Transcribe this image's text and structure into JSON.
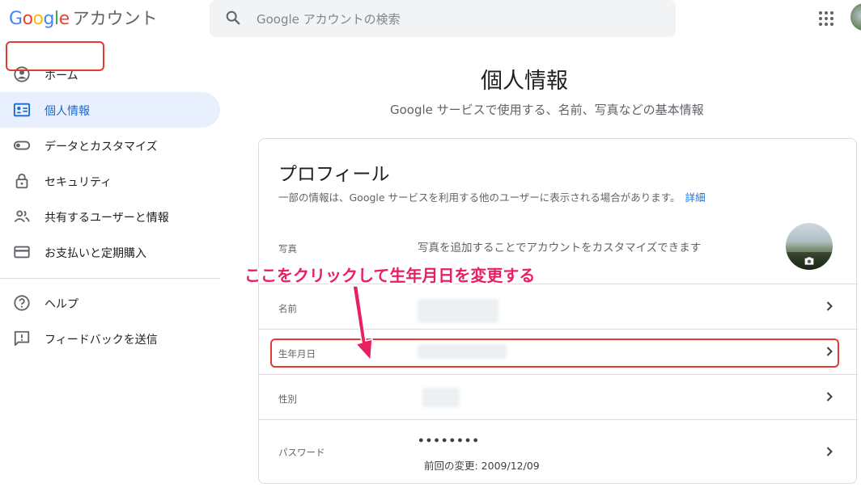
{
  "header": {
    "logo_letters": [
      "G",
      "o",
      "o",
      "g",
      "l",
      "e"
    ],
    "product_name": "アカウント",
    "search_placeholder": "Google アカウントの検索"
  },
  "sidebar": {
    "items": [
      {
        "label": "ホーム",
        "icon": "account-circle-icon"
      },
      {
        "label": "個人情報",
        "icon": "id-card-icon",
        "active": true
      },
      {
        "label": "データとカスタマイズ",
        "icon": "toggle-icon"
      },
      {
        "label": "セキュリティ",
        "icon": "lock-icon"
      },
      {
        "label": "共有するユーザーと情報",
        "icon": "people-icon"
      },
      {
        "label": "お支払いと定期購入",
        "icon": "credit-card-icon"
      }
    ],
    "secondary_items": [
      {
        "label": "ヘルプ",
        "icon": "help-circle-icon"
      },
      {
        "label": "フィードバックを送信",
        "icon": "feedback-icon"
      }
    ]
  },
  "main": {
    "title": "個人情報",
    "subtitle": "Google サービスで使用する、名前、写真などの基本情報"
  },
  "profile_card": {
    "title": "プロフィール",
    "description": "一部の情報は、Google サービスを利用する他のユーザーに表示される場合があります。",
    "details_link": "詳細",
    "rows": {
      "photo": {
        "label": "写真",
        "value": "写真を追加することでアカウントをカスタマイズできます"
      },
      "name": {
        "label": "名前"
      },
      "birthday": {
        "label": "生年月日"
      },
      "gender": {
        "label": "性別"
      },
      "password": {
        "label": "パスワード",
        "value": "••••••••",
        "last_changed": "前回の変更: 2009/12/09"
      }
    }
  },
  "annotation": {
    "text": "ここをクリックして生年月日を変更する",
    "color": "#e91e63"
  },
  "colors": {
    "accent": "#1a73e8",
    "active_bg": "#e8f0fe",
    "highlight_border": "#e53935"
  }
}
